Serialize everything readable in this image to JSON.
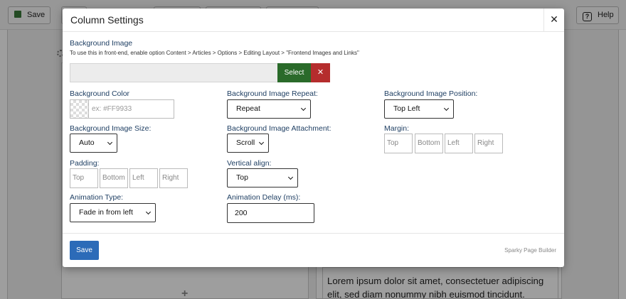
{
  "toolbar": {
    "save_label": "Save",
    "help_label": "Help"
  },
  "background": {
    "lorem_text": "Lorem ipsum dolor sit amet, consectetuer adipiscing elit, sed diam nonummy nibh euismod tincidunt. Lorem ipsum"
  },
  "modal": {
    "title": "Column Settings",
    "close_label": "✕",
    "bg_image": {
      "label": "Background Image",
      "hint": "To use this in front-end, enable option Content > Articles > Options > Editing Layout > \"Frontend Images and Links\"",
      "value": "",
      "select_label": "Select",
      "clear_label": "✕"
    },
    "bg_color": {
      "label": "Background Color",
      "placeholder": "ex: #FF9933"
    },
    "bg_repeat": {
      "label": "Background Image Repeat:",
      "value": "Repeat"
    },
    "bg_position": {
      "label": "Background Image Position:",
      "value": "Top Left"
    },
    "bg_size": {
      "label": "Background Image Size:",
      "value": "Auto"
    },
    "bg_attachment": {
      "label": "Background Image Attachment:",
      "value": "Scroll"
    },
    "margin": {
      "label": "Margin:",
      "top": "Top",
      "bottom": "Bottom",
      "left": "Left",
      "right": "Right"
    },
    "padding": {
      "label": "Padding:",
      "top": "Top",
      "bottom": "Bottom",
      "left": "Left",
      "right": "Right"
    },
    "valign": {
      "label": "Vertical align:",
      "value": "Top"
    },
    "anim_type": {
      "label": "Animation Type:",
      "value": "Fade in from left"
    },
    "anim_delay": {
      "label": "Animation Delay (ms):",
      "value": "200"
    },
    "footer": {
      "save_label": "Save",
      "brand": "Sparky Page Builder"
    }
  }
}
